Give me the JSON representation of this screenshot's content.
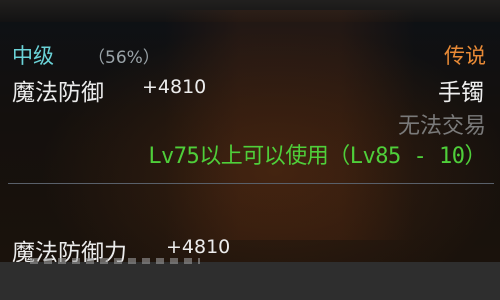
{
  "item": {
    "rank": "中级",
    "percent": "（56%）",
    "quality": "传说",
    "stat_name": "魔法防御",
    "stat_value": "+4810",
    "slot": "手镯",
    "trade": "无法交易",
    "level_req": "Lv75以上可以使用（Lv85 - 10）",
    "stat2_name": "魔法防御力",
    "stat2_value": "+4810"
  },
  "colors": {
    "rank": "#6bd3d8",
    "quality": "#e98a36",
    "level_req": "#4fcf3a",
    "trade": "#7a7a7a"
  }
}
